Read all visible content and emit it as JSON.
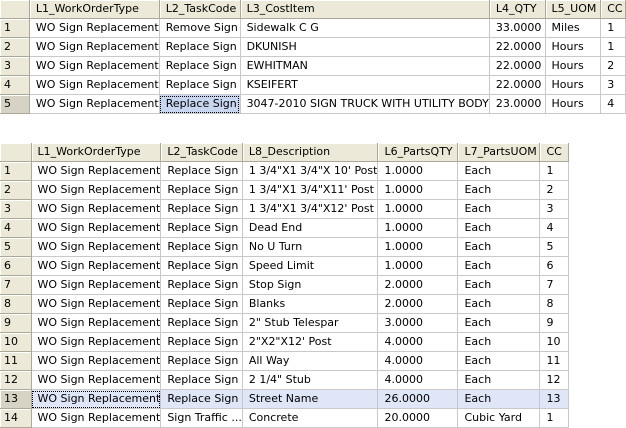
{
  "grid1": {
    "columns": [
      "",
      "L1_WorkOrderType",
      "L2_TaskCode",
      "L3_CostItem",
      "L4_QTY",
      "L5_UOM",
      "CC"
    ],
    "rows": [
      [
        "1",
        "WO Sign Replacement",
        "Remove Sign",
        "Sidewalk C G",
        "33.0000",
        "Miles",
        "1"
      ],
      [
        "2",
        "WO Sign Replacement",
        "Replace Sign",
        "DKUNISH",
        "22.0000",
        "Hours",
        "1"
      ],
      [
        "3",
        "WO Sign Replacement",
        "Replace Sign",
        "EWHITMAN",
        "22.0000",
        "Hours",
        "2"
      ],
      [
        "4",
        "WO Sign Replacement",
        "Replace Sign",
        "KSEIFERT",
        "22.0000",
        "Hours",
        "3"
      ],
      [
        "5",
        "WO Sign Replacement",
        "Replace Sign",
        "3047-2010 SIGN TRUCK WITH UTILITY BODY",
        "23.0000",
        "Hours",
        "4"
      ]
    ]
  },
  "grid2": {
    "columns": [
      "",
      "L1_WorkOrderType",
      "L2_TaskCode",
      "L8_Description",
      "L6_PartsQTY",
      "L7_PartsUOM",
      "CC"
    ],
    "rows": [
      [
        "1",
        "WO Sign Replacement",
        "Replace Sign",
        "1 3/4\"X1 3/4\"X 10' Post",
        "1.0000",
        "Each",
        "1"
      ],
      [
        "2",
        "WO Sign Replacement",
        "Replace Sign",
        "1 3/4\"X1 3/4\"X11' Post",
        "1.0000",
        "Each",
        "2"
      ],
      [
        "3",
        "WO Sign Replacement",
        "Replace Sign",
        "1 3/4\"X1 3/4\"X12' Post",
        "1.0000",
        "Each",
        "3"
      ],
      [
        "4",
        "WO Sign Replacement",
        "Replace Sign",
        "Dead End",
        "1.0000",
        "Each",
        "4"
      ],
      [
        "5",
        "WO Sign Replacement",
        "Replace Sign",
        "No U Turn",
        "1.0000",
        "Each",
        "5"
      ],
      [
        "6",
        "WO Sign Replacement",
        "Replace Sign",
        "Speed Limit",
        "1.0000",
        "Each",
        "6"
      ],
      [
        "7",
        "WO Sign Replacement",
        "Replace Sign",
        "Stop Sign",
        "2.0000",
        "Each",
        "7"
      ],
      [
        "8",
        "WO Sign Replacement",
        "Replace Sign",
        "Blanks",
        "2.0000",
        "Each",
        "8"
      ],
      [
        "9",
        "WO Sign Replacement",
        "Replace Sign",
        "2\" Stub Telespar",
        "3.0000",
        "Each",
        "9"
      ],
      [
        "10",
        "WO Sign Replacement",
        "Replace Sign",
        "2\"X2\"X12' Post",
        "4.0000",
        "Each",
        "10"
      ],
      [
        "11",
        "WO Sign Replacement",
        "Replace Sign",
        "All Way",
        "4.0000",
        "Each",
        "11"
      ],
      [
        "12",
        "WO Sign Replacement",
        "Replace Sign",
        "2 1/4\" Stub",
        "4.0000",
        "Each",
        "12"
      ],
      [
        "13",
        "WO Sign Replacement",
        "Replace Sign",
        "Street Name",
        "26.0000",
        "Each",
        "13"
      ],
      [
        "14",
        "WO Sign Replacement",
        "Sign Traffic ...",
        "Concrete",
        "20.0000",
        "Cubic Yard",
        "1"
      ]
    ]
  }
}
